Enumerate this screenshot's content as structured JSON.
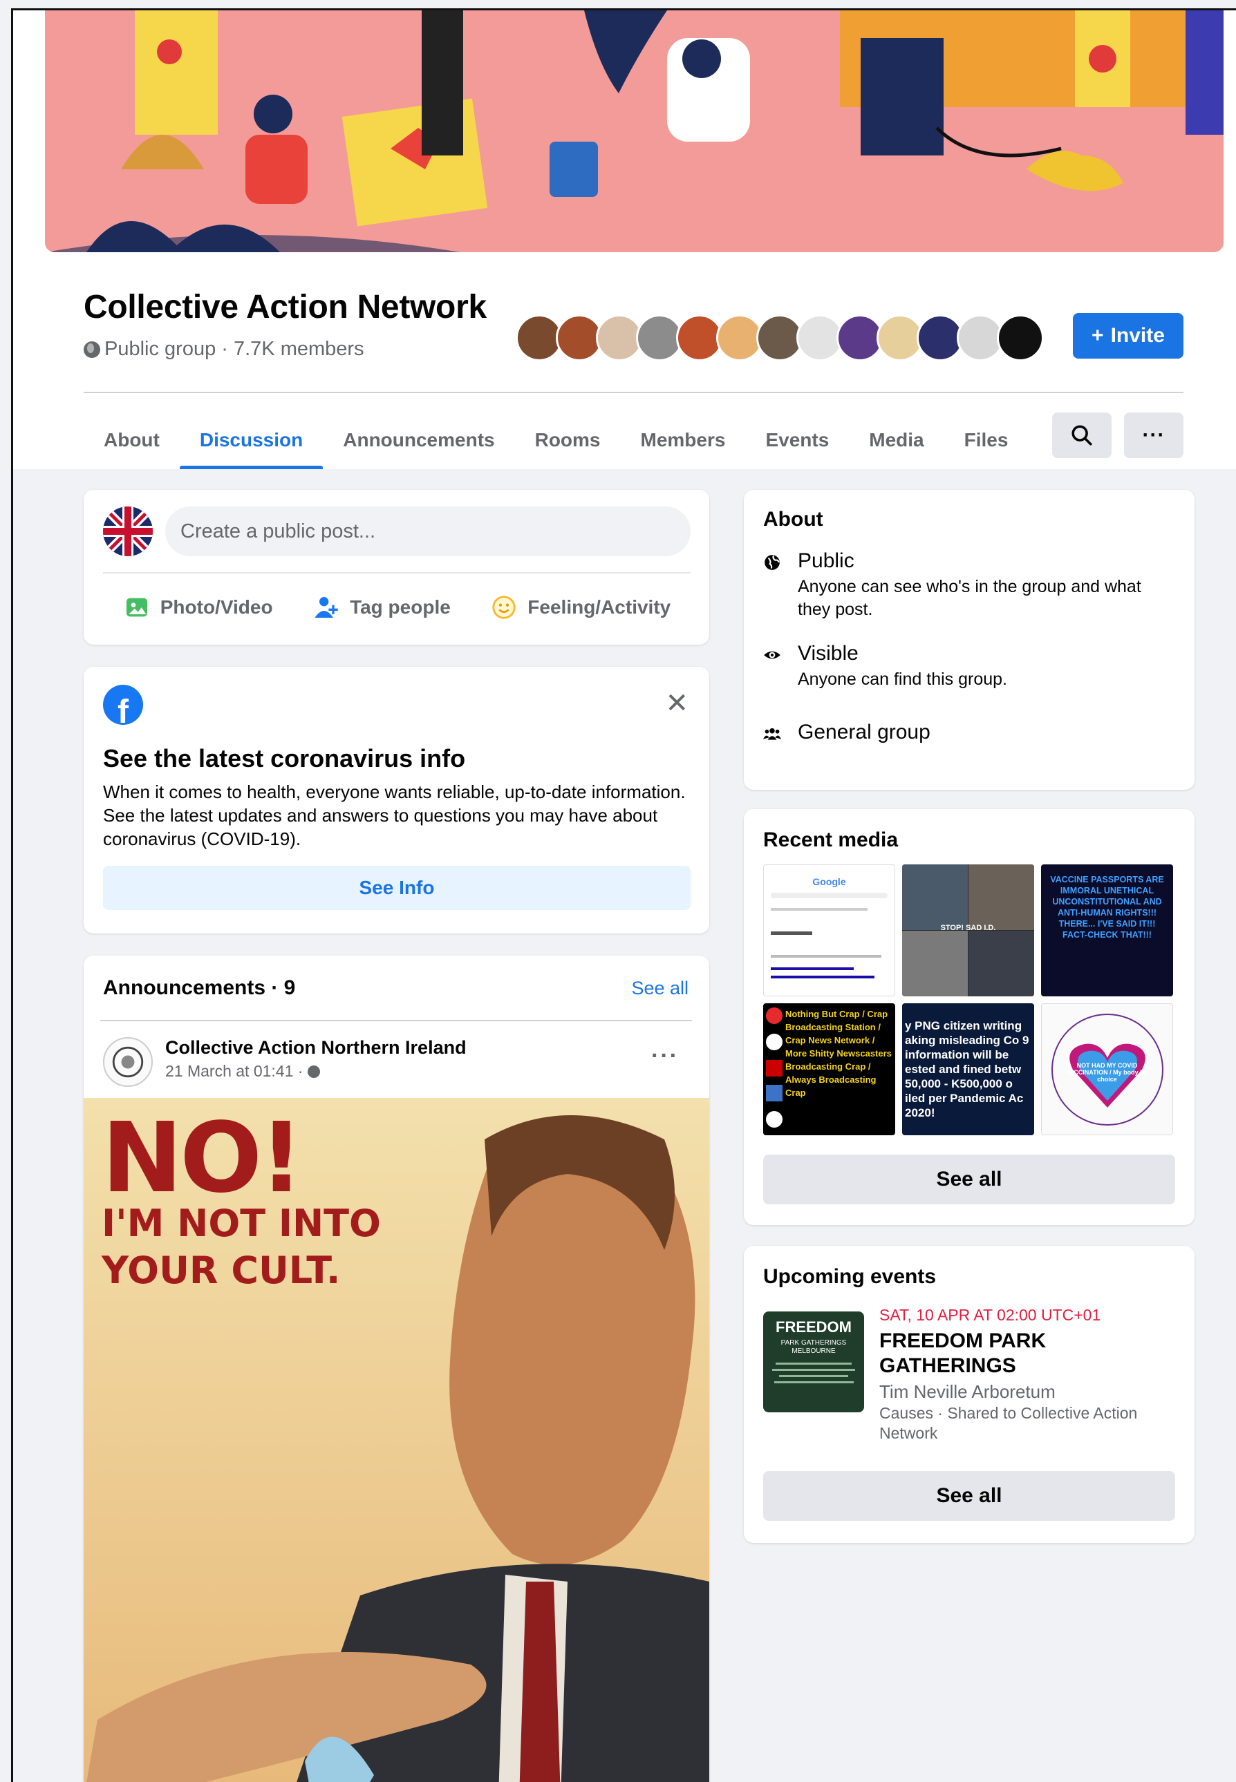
{
  "group": {
    "name": "Collective Action Network",
    "meta": "Public group · 7.7K members",
    "invite_label": "Invite"
  },
  "tabs": [
    "About",
    "Discussion",
    "Announcements",
    "Rooms",
    "Members",
    "Events",
    "Media",
    "Files"
  ],
  "active_tab": "Discussion",
  "composer": {
    "placeholder": "Create a public post...",
    "actions": [
      "Photo/Video",
      "Tag people",
      "Feeling/Activity"
    ]
  },
  "covid_card": {
    "title": "See the latest coronavirus info",
    "body": "When it comes to health, everyone wants reliable, up-to-date information. See the latest updates and answers to questions you may have about coronavirus (COVID-19).",
    "button": "See Info"
  },
  "announcements": {
    "title": "Announcements · 9",
    "see_all": "See all",
    "post": {
      "author": "Collective Action Northern Ireland",
      "meta": "21 March at 01:41 ·",
      "poster_line1": "NO!",
      "poster_line2": "I'M NOT INTO",
      "poster_line3": "YOUR CULT."
    }
  },
  "about": {
    "title": "About",
    "items": [
      {
        "title": "Public",
        "desc": "Anyone can see who's in the group and what they post."
      },
      {
        "title": "Visible",
        "desc": "Anyone can find this group."
      },
      {
        "title": "General group",
        "desc": ""
      }
    ]
  },
  "recent_media": {
    "title": "Recent media",
    "see_all": "See all",
    "thumbs": [
      {
        "text": "Google"
      },
      {
        "text": "STOP! SAD I.D."
      },
      {
        "text": "VACCINE PASSPORTS ARE IMMORAL UNETHICAL UNCONSTITUTIONAL AND ANTI-HUMAN RIGHTS!!! THERE... I'VE SAID IT!!! FACT-CHECK THAT!!!"
      },
      {
        "text": "Nothing But Crap / Crap Broadcasting Station / Crap News Network / More Shitty Newscasters Broadcasting Crap / Always Broadcasting Crap"
      },
      {
        "text": "y PNG citizen writing aking misleading Co 9 information will be ested and fined betw 50,000 - K500,000 o iled per Pandemic Ac 2020!"
      },
      {
        "text": "NOT HAD MY COVID VACCINATION / My body My choice"
      }
    ]
  },
  "events": {
    "title": "Upcoming events",
    "date": "SAT, 10 APR AT 02:00 UTC+01",
    "name": "FREEDOM PARK GATHERINGS",
    "location": "Tim Neville Arboretum",
    "sub": "Causes · Shared to Collective Action Network",
    "thumb_title": "FREEDOM",
    "thumb_sub": "PARK GATHERINGS MELBOURNE",
    "see_all": "See all"
  },
  "colors": {
    "accent": "#1b74e4",
    "event_date": "#e41e3f",
    "page_bg": "#f0f2f5"
  }
}
